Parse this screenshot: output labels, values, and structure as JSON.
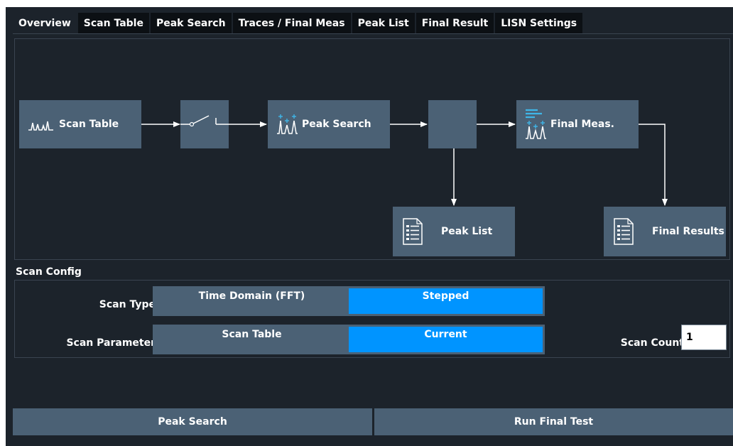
{
  "tabs": [
    {
      "label": "Overview",
      "active": true
    },
    {
      "label": "Scan Table",
      "active": false
    },
    {
      "label": "Peak Search",
      "active": false
    },
    {
      "label": "Traces / Final Meas",
      "active": false
    },
    {
      "label": "Peak List",
      "active": false
    },
    {
      "label": "Final Result",
      "active": false
    },
    {
      "label": "LISN Settings",
      "active": false
    }
  ],
  "diagram": {
    "scan_table": {
      "label": "Scan Table",
      "icon": "scan-trace-icon"
    },
    "switch": {
      "icon": "switch-icon"
    },
    "peak_search": {
      "label": "Peak Search",
      "icon": "peak-search-icon"
    },
    "router": {
      "icon": "router-block"
    },
    "final_meas": {
      "label": "Final Meas.",
      "icon": "final-meas-icon"
    },
    "peak_list": {
      "label": "Peak List",
      "icon": "list-document-icon"
    },
    "final_results": {
      "label": "Final Results",
      "icon": "list-document-icon"
    }
  },
  "scan_config": {
    "title": "Scan Config",
    "scan_type": {
      "label": "Scan Type",
      "options": [
        "Time Domain (FFT)",
        "Stepped"
      ],
      "selected": "Stepped"
    },
    "scan_parameter": {
      "label": "Scan Parameter",
      "options": [
        "Scan Table",
        "Current"
      ],
      "selected": "Current"
    },
    "scan_count": {
      "label": "Scan Count",
      "value": "1"
    }
  },
  "buttons": {
    "peak_search": "Peak Search",
    "run_final_test": "Run Final Test"
  },
  "colors": {
    "background": "#1c232b",
    "block": "#4b6175",
    "selected": "#0094ff",
    "icon_accent": "#3fb6e8",
    "tab_inactive": "#0c1014"
  }
}
